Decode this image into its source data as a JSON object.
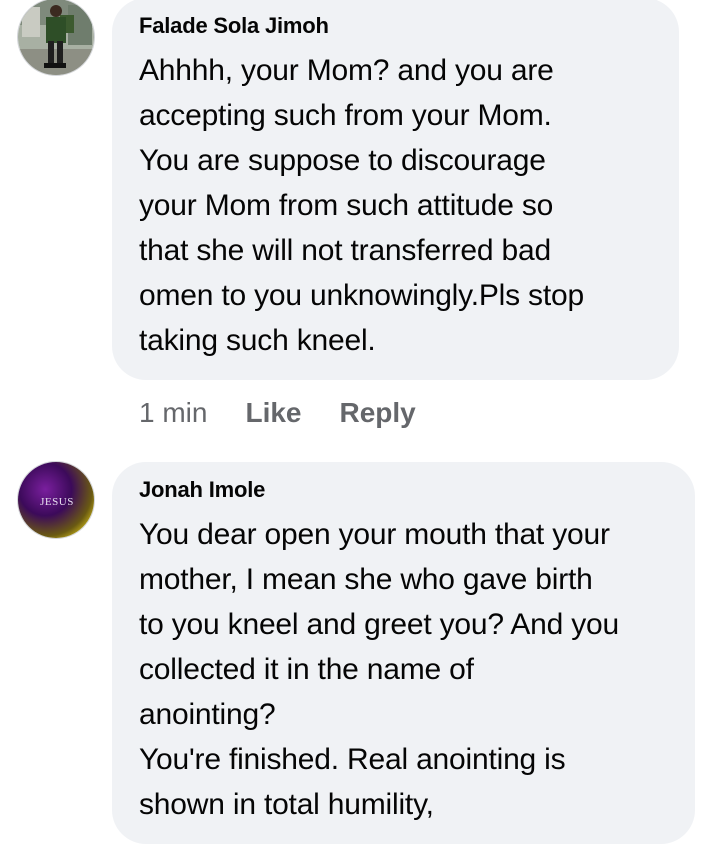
{
  "comments": [
    {
      "author": "Falade Sola Jimoh",
      "lines": [
        "Ahhhh, your Mom? and you are",
        "accepting such from your Mom.",
        "You are suppose to discourage",
        "your Mom from such attitude so",
        "that she will not transferred bad",
        "omen to you unknowingly.Pls stop",
        "taking such kneel."
      ],
      "time": "1 min",
      "like_label": "Like",
      "reply_label": "Reply",
      "avatar_icon": "person-photo-icon"
    },
    {
      "author": "Jonah Imole",
      "lines": [
        "You dear open your mouth that your",
        "mother, I mean she who gave birth",
        "to you kneel and greet you? And you",
        "collected it in the name of",
        "anointing?",
        "You're finished. Real anointing is",
        "shown in total humility,"
      ],
      "avatar_text": "JESUS",
      "avatar_icon": "jesus-text-avatar-icon"
    }
  ],
  "colors": {
    "bubble": "#f0f2f5",
    "meta": "#65676b",
    "text": "#050505"
  }
}
